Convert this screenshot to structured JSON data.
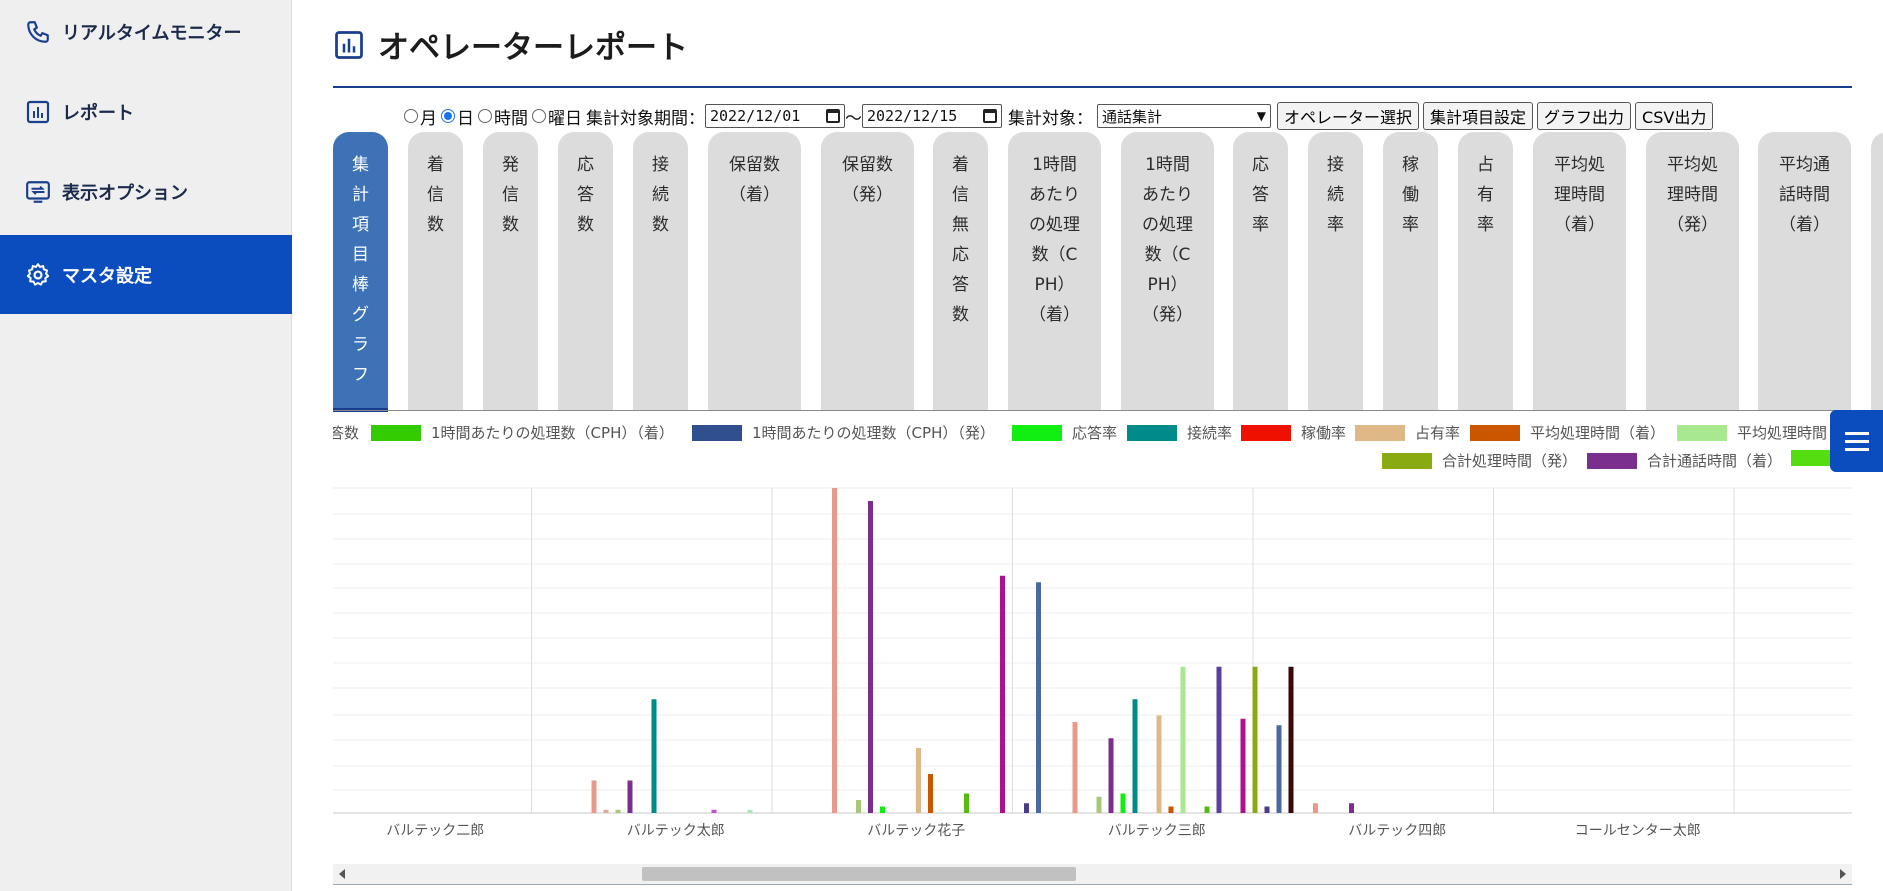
{
  "sidebar": {
    "items": [
      {
        "label": "リアルタイムモニター",
        "icon": "phone-icon"
      },
      {
        "label": "レポート",
        "icon": "bar-chart-icon"
      },
      {
        "label": "表示オプション",
        "icon": "display-options-icon"
      },
      {
        "label": "マスタ設定",
        "icon": "gear-icon",
        "active": true
      }
    ],
    "accent": "#0b4cbf"
  },
  "header": {
    "title": "オペレーターレポート"
  },
  "controls": {
    "radios": [
      {
        "label": "月",
        "checked": false
      },
      {
        "label": "日",
        "checked": true
      },
      {
        "label": "時間",
        "checked": false
      },
      {
        "label": "曜日",
        "checked": false
      }
    ],
    "period_label": "集計対象期間：",
    "date_from": "2022/12/01",
    "tilde": "～",
    "date_to": "2022/12/15",
    "target_label": "集計対象：",
    "target_value": "通話集計",
    "buttons": {
      "operator": "オペレーター選択",
      "items": "集計項目設定",
      "graph": "グラフ出力",
      "csv": "CSV出力"
    }
  },
  "tabs": [
    {
      "label": "集\n計\n項\n目\n棒\nグ\nラ\nフ",
      "active": true
    },
    {
      "label": "着\n信\n数"
    },
    {
      "label": "発\n信\n数"
    },
    {
      "label": "応\n答\n数"
    },
    {
      "label": "接\n続\n数"
    },
    {
      "label": "保留数\n（着）"
    },
    {
      "label": "保留数\n（発）"
    },
    {
      "label": "着\n信\n無\n応\n答\n数"
    },
    {
      "label": "1時間\nあたり\nの処理\n数（C\nPH）\n（着）"
    },
    {
      "label": "1時間\nあたり\nの処理\n数（C\nPH）\n（発）"
    },
    {
      "label": "応\n答\n率"
    },
    {
      "label": "接\n続\n率"
    },
    {
      "label": "稼\n働\n率"
    },
    {
      "label": "占\n有\n率"
    },
    {
      "label": "平均処\n理時間\n（着）"
    },
    {
      "label": "平均処\n理時間\n（発）"
    },
    {
      "label": "平均通\n話時間\n（着）"
    }
  ],
  "legend": {
    "row1": [
      {
        "name": "答数",
        "color": ""
      },
      {
        "name": "1時間あたりの処理数（CPH）（着）",
        "color": "#33cc00"
      },
      {
        "name": "1時間あたりの処理数（CPH）（発）",
        "color": "#2f4f8f"
      },
      {
        "name": "応答率",
        "color": "#11ee11"
      },
      {
        "name": "接続率",
        "color": "#008b8b"
      },
      {
        "name": "稼働率",
        "color": "#ee1100"
      },
      {
        "name": "占有率",
        "color": "#deb887"
      },
      {
        "name": "平均処理時間（着）",
        "color": "#cc5500"
      },
      {
        "name": "平均処理時間",
        "color": "#a8e890"
      }
    ],
    "row2": [
      {
        "name": "合計処理時間（発）",
        "color": "#8aaa11"
      },
      {
        "name": "合計通話時間（着）",
        "color": "#7a2f8f"
      },
      {
        "name": "",
        "color": "#55dd11"
      }
    ]
  },
  "chart_data": {
    "type": "bar",
    "categories": [
      "バルテック二郎",
      "バルテック太郎",
      "バルテック花子",
      "バルテック三郎",
      "バルテック四郎",
      "コールセンター太郎"
    ],
    "ylim": [
      0,
      100
    ],
    "grid": true,
    "series": [
      {
        "name": "",
        "color": "#e9998a",
        "values": [
          0,
          10,
          100,
          28,
          3,
          0
        ]
      },
      {
        "name": "",
        "color": "#ddaa99",
        "values": [
          0,
          1,
          0,
          0,
          0,
          0
        ]
      },
      {
        "name": "",
        "color": "#a8c878",
        "values": [
          0,
          1,
          4,
          5,
          0,
          0
        ]
      },
      {
        "name": "",
        "color": "#7a2f8f",
        "values": [
          0,
          10,
          96,
          23,
          3,
          0
        ]
      },
      {
        "name": "応答率",
        "color": "#11ee11",
        "values": [
          0,
          0,
          2,
          6,
          0,
          0
        ]
      },
      {
        "name": "接続率",
        "color": "#008b8b",
        "values": [
          0,
          35,
          0,
          35,
          0,
          0
        ]
      },
      {
        "name": "",
        "color": "#c71585",
        "values": [
          0,
          0,
          0,
          0,
          0,
          0
        ]
      },
      {
        "name": "占有率",
        "color": "#deb887",
        "values": [
          0,
          0,
          20,
          30,
          0,
          0
        ]
      },
      {
        "name": "平均処理時間（着）",
        "color": "#cc5500",
        "values": [
          0,
          0,
          12,
          2,
          0,
          0
        ]
      },
      {
        "name": "平均処理時間",
        "color": "#a8e890",
        "values": [
          0,
          0,
          0,
          45,
          0,
          0
        ]
      },
      {
        "name": "",
        "color": "#bb55cc",
        "values": [
          0,
          1,
          0,
          0,
          0,
          0
        ]
      },
      {
        "name": "",
        "color": "#55bb11",
        "values": [
          0,
          0,
          6,
          2,
          0,
          0
        ]
      },
      {
        "name": "",
        "color": "#5a3f9f",
        "values": [
          0,
          0,
          0,
          45,
          0,
          0
        ]
      },
      {
        "name": "",
        "color": "#a8e8c0",
        "values": [
          0,
          1,
          0,
          0,
          0,
          0
        ]
      },
      {
        "name": "",
        "color": "#b0108f",
        "values": [
          0,
          0,
          73,
          29,
          0,
          0
        ]
      },
      {
        "name": "合計処理時間（発）",
        "color": "#8aaa11",
        "values": [
          0,
          0,
          0,
          45,
          0,
          0
        ]
      },
      {
        "name": "",
        "color": "#483d8b",
        "values": [
          0,
          0,
          3,
          2,
          0,
          0
        ]
      },
      {
        "name": "",
        "color": "#4a6a9f",
        "values": [
          0,
          0,
          71,
          27,
          0,
          0
        ]
      },
      {
        "name": "",
        "color": "#3a0a0a",
        "values": [
          0,
          0,
          0,
          45,
          0,
          0
        ]
      }
    ]
  }
}
